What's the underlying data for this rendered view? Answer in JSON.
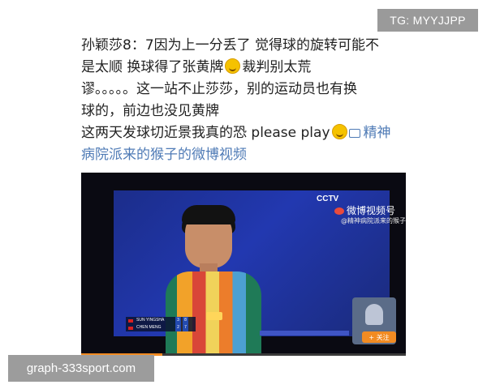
{
  "tg_badge": "TG: MYYJJPP",
  "post": {
    "line1": "孙颖莎8：7因为上一分丢了 觉得球的旋转可能不",
    "line2a": "是太顺 换球得了张黄牌",
    "emoji1": "grinning-sweat-emoji",
    "line2b": "裁判别太荒",
    "line3": "谬。。。。。这一站不止莎莎，别的运动员也有换",
    "line4": "球的，前边也没见黄牌",
    "line5": "这两天发球切近景我真的恐 please play",
    "emoji2": "upside-down-face-emoji",
    "link_line1": "精神",
    "link_line2": "病院派来的猴子的微博视频"
  },
  "video": {
    "cctv_logo": "CCTV",
    "weibo_video_label": "微博视频号",
    "channel_name": "@精神病院派来的猴子",
    "scoreboard": [
      {
        "name": "SUN YINGSHA",
        "game": "3",
        "points": "8"
      },
      {
        "name": "CHEN MENG",
        "game": "2",
        "points": "7"
      }
    ],
    "follow_label": "+ 关注",
    "progress": 0.25
  },
  "watermark": "graph-333sport.com",
  "colors": {
    "link": "#4f7bb6",
    "badge_bg": "#9a9a9a",
    "video_bg": "#0a0a12",
    "follow_orange": "#f28b22"
  }
}
